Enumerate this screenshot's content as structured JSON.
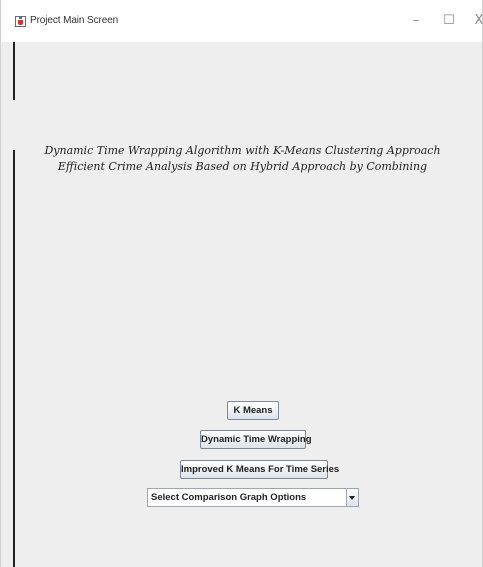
{
  "window": {
    "title": "Project Main Screen",
    "controls": {
      "minimize": "–",
      "maximize": "☐",
      "close": "X"
    }
  },
  "main": {
    "heading_line1": "Dynamic Time Wrapping Algorithm with K-Means Clustering Approach",
    "heading_line2": "Efficient Crime Analysis Based on Hybrid Approach by Combining"
  },
  "buttons": {
    "kmeans": "K Means",
    "dtw": "Dynamic Time Wrapping",
    "improved_kmeans": "Improved K Means For Time Series"
  },
  "comparison_select": {
    "selected": "Select Comparison Graph Options"
  },
  "icons": {
    "app": "java-cup-icon",
    "dropdown": "triangle-down-icon"
  }
}
